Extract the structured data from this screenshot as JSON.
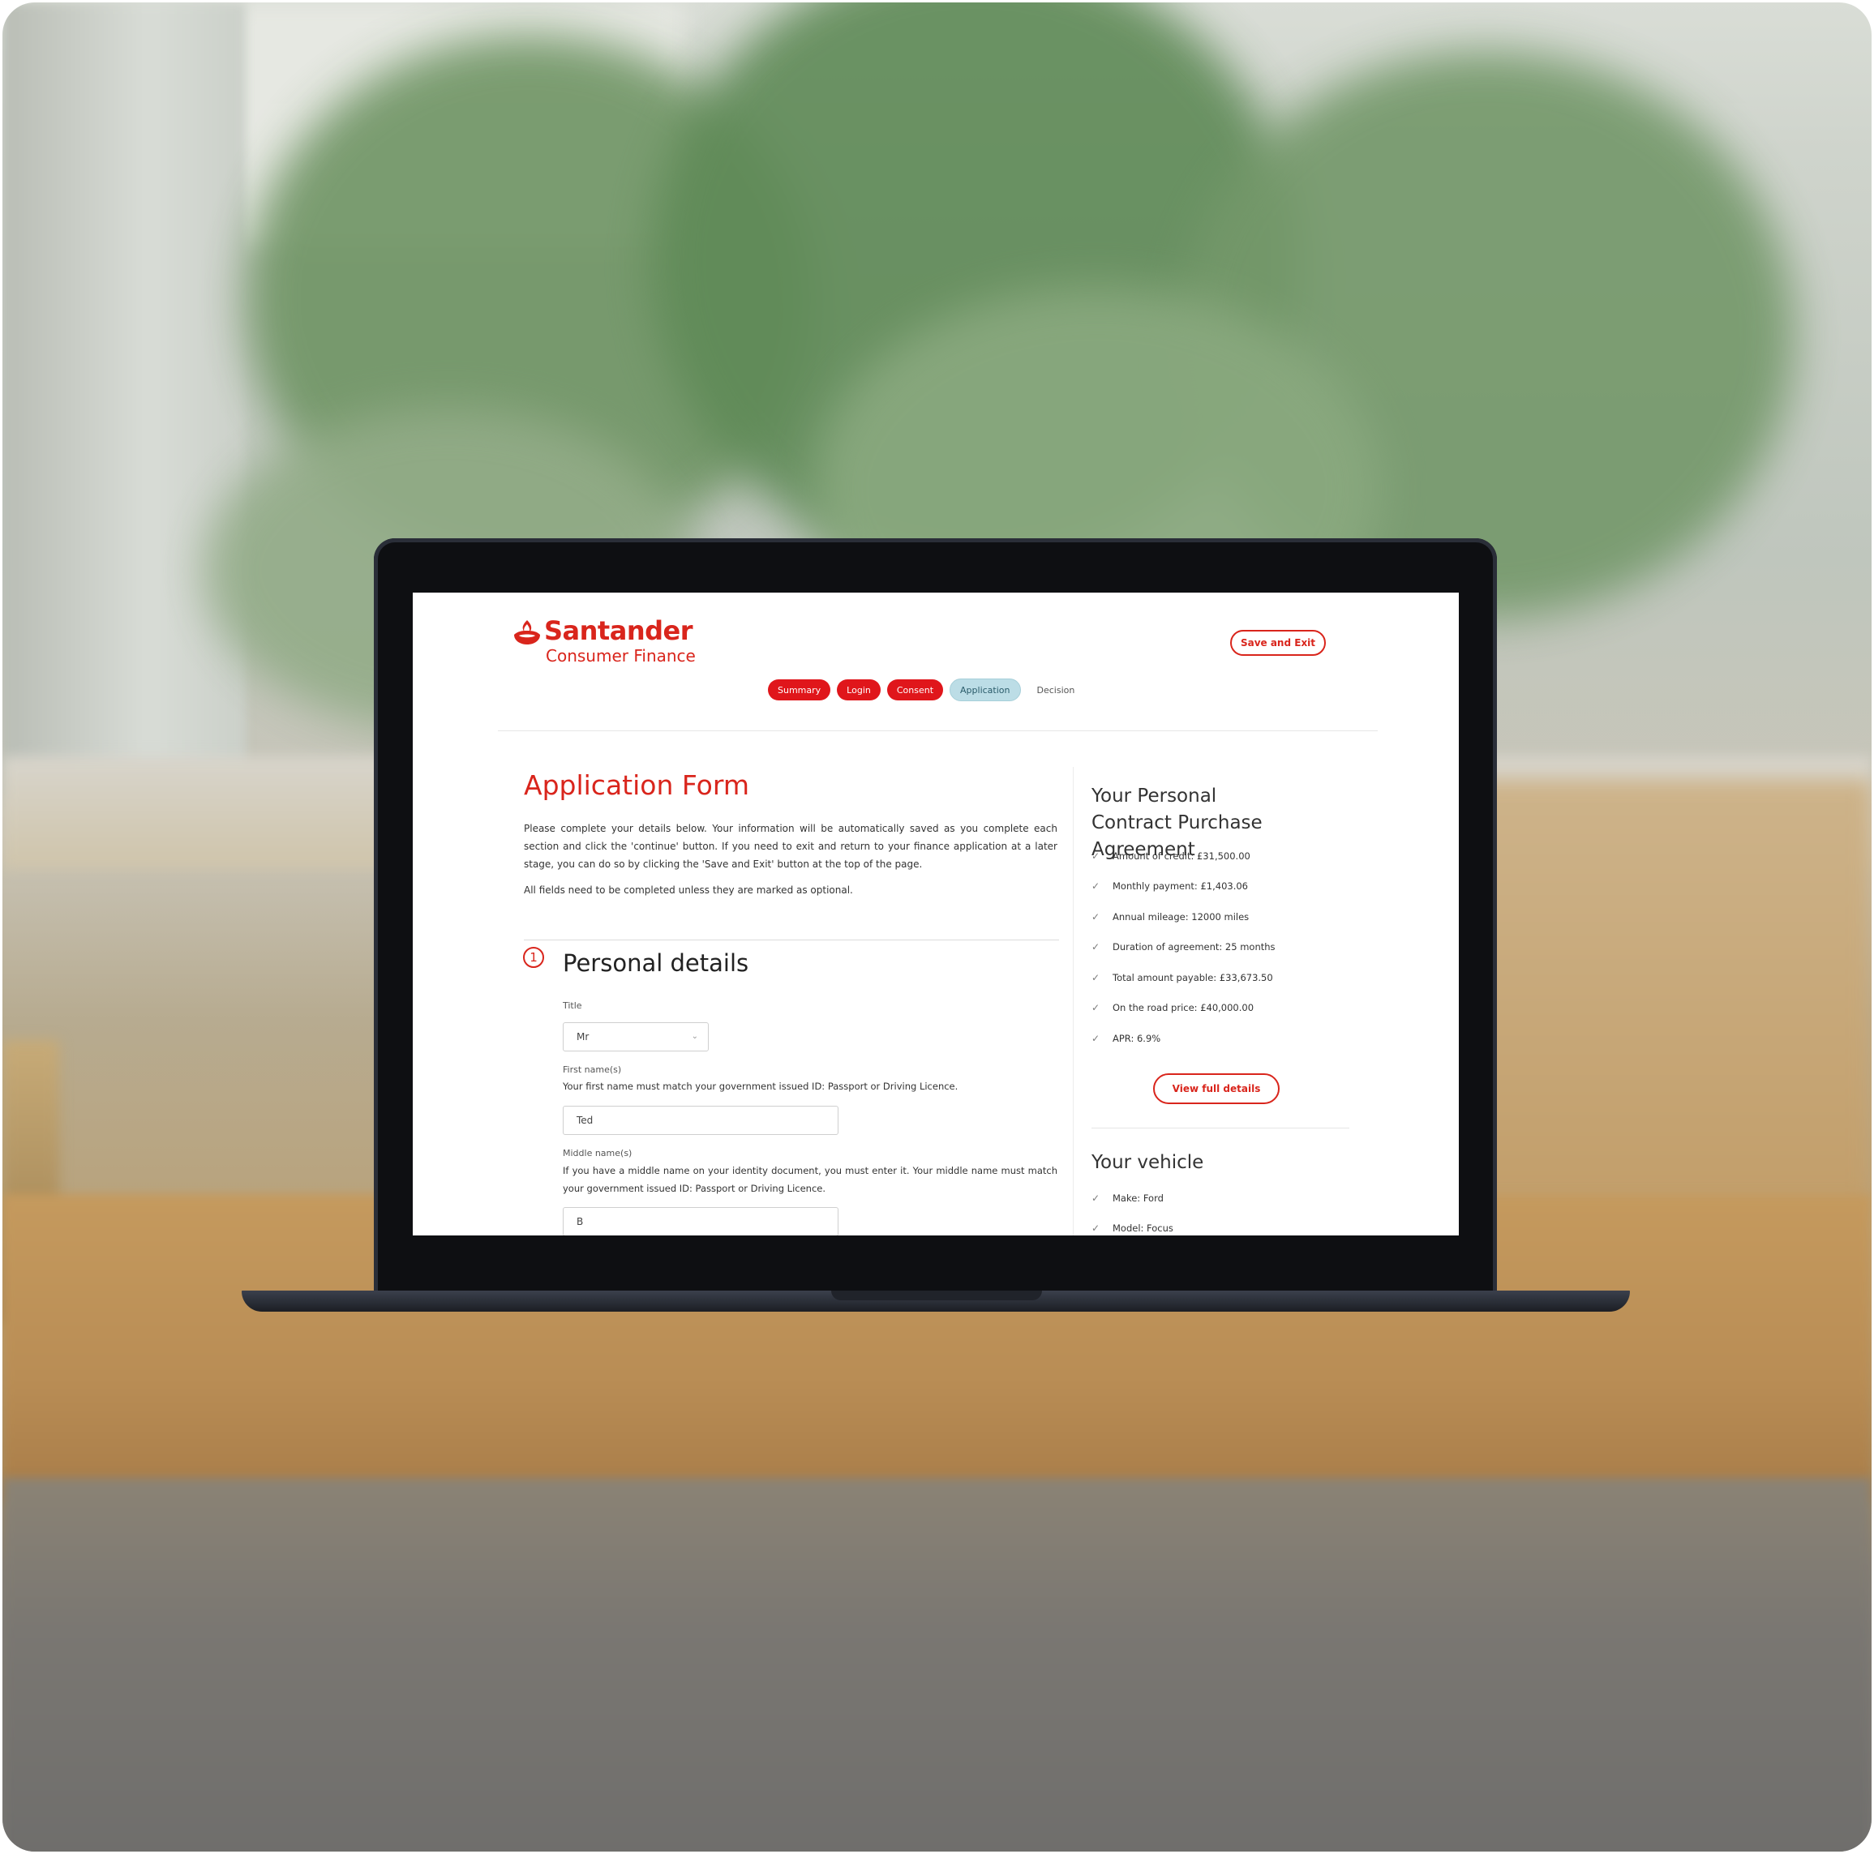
{
  "brand": {
    "name": "Santander",
    "subtitle": "Consumer Finance",
    "color": "#d9251c"
  },
  "header": {
    "save_exit_label": "Save and Exit"
  },
  "steps": [
    {
      "label": "Summary",
      "state": "done"
    },
    {
      "label": "Login",
      "state": "done"
    },
    {
      "label": "Consent",
      "state": "done"
    },
    {
      "label": "Application",
      "state": "current"
    },
    {
      "label": "Decision",
      "state": "todo"
    }
  ],
  "form": {
    "title": "Application Form",
    "intro": "Please complete your details below. Your information will be automatically saved as you complete each section and click the 'continue' button. If you need to exit and return to your finance application at a later stage, you can do so by clicking the 'Save and Exit' button at the top of the page.",
    "note": "All fields need to be completed unless they are marked as optional.",
    "section_number": "1",
    "section_title": "Personal details",
    "fields": {
      "title_label": "Title",
      "title_value": "Mr",
      "first_name_label": "First name(s)",
      "first_name_help": "Your first name must match your government issued ID: Passport or Driving Licence.",
      "first_name_value": "Ted",
      "middle_name_label": "Middle name(s)",
      "middle_name_help": "If you have a middle name on your identity document, you must enter it. Your middle name must match your government issued ID: Passport or Driving Licence.",
      "middle_name_value": "B"
    }
  },
  "agreement": {
    "title": "Your Personal Contract Purchase Agreement",
    "items": [
      "Amount of credit: £31,500.00",
      "Monthly payment: £1,403.06",
      "Annual mileage: 12000 miles",
      "Duration of agreement: 25 months",
      "Total amount payable: £33,673.50",
      "On the road price: £40,000.00",
      "APR: 6.9%"
    ],
    "view_details_label": "View full details"
  },
  "vehicle": {
    "title": "Your vehicle",
    "items": [
      "Make: Ford",
      "Model: Focus"
    ]
  },
  "icons": {
    "check": "check-icon",
    "chevron": "chevron-down-icon",
    "logo": "santander-flame-icon"
  }
}
